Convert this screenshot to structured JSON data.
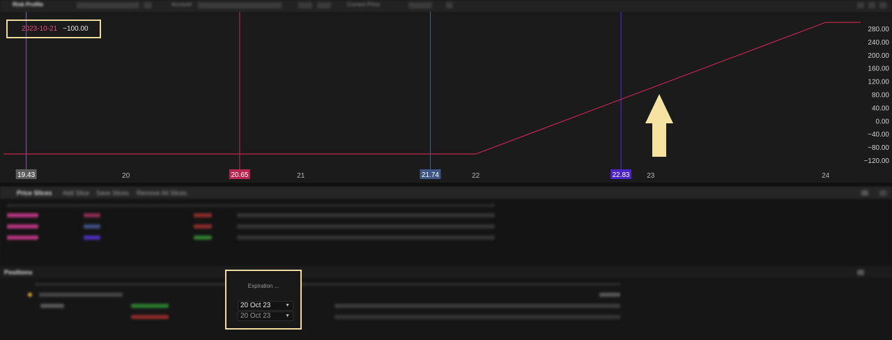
{
  "topbar": {
    "title": "Risk Profile",
    "account_label": "Account",
    "display_label": "Current Price"
  },
  "chart_data": {
    "type": "line",
    "x_ticks": [
      "20",
      "21",
      "22",
      "23",
      "24"
    ],
    "y_ticks": [
      "280.00",
      "240.00",
      "200.00",
      "160.00",
      "120.00",
      "80.00",
      "40.00",
      "0.00",
      "−40.00",
      "−80.00",
      "−120.00"
    ],
    "xlim": [
      19.3,
      24.2
    ],
    "ylim": [
      -138,
      315
    ],
    "series": [
      {
        "x": [
          19.3,
          22.0,
          24.0,
          24.2
        ],
        "y": [
          -100,
          -100,
          300,
          300
        ],
        "color": "#c2254e"
      }
    ],
    "vlines": [
      {
        "x": 19.43,
        "label": "19.43",
        "line_color": "#8a56c0",
        "badge_color": "#5c5c5c"
      },
      {
        "x": 20.65,
        "label": "20.65",
        "line_color": "#c2254e",
        "badge_color": "#b62650"
      },
      {
        "x": 21.74,
        "label": "21.74",
        "line_color": "#4a5f86",
        "badge_color": "#3e5585"
      },
      {
        "x": 22.83,
        "label": "22.83",
        "line_color": "#5a2bd6",
        "badge_color": "#4b22c5"
      }
    ],
    "hover": {
      "date": "2023-10-21",
      "value": "−100.00"
    },
    "arrow_color": "#f6e3a1"
  },
  "price_slices": {
    "tabs": [
      "Price Slices",
      "Add Slice",
      "Save Slices",
      "Remove All Slices"
    ]
  },
  "positions": {
    "title": "Positions",
    "expiration_header": "Expiration",
    "expirations": [
      "20 Oct 23",
      "20 Oct 23"
    ]
  }
}
